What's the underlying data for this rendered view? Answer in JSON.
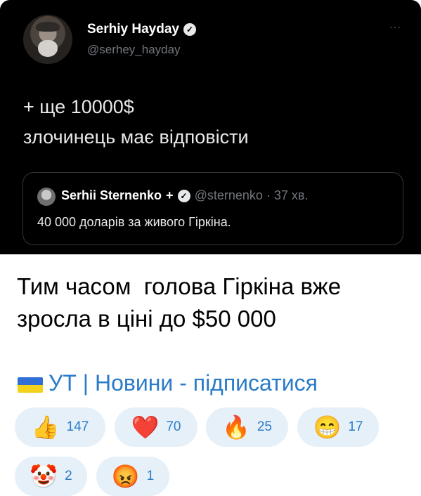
{
  "tweet": {
    "author_name": "Serhiy Hayday",
    "author_handle": "@serhey_hayday",
    "more_label": "···",
    "lines": [
      "+ ще 10000$",
      "злочинець має відповісти"
    ],
    "quote": {
      "author_name": "Serhii Sternenko",
      "cross": "+",
      "meta": "@sternenko · 37 хв.",
      "text": "40 000 доларів за живого Гіркіна."
    }
  },
  "post": {
    "lines": [
      "Тим часом  голова Гіркіна вже",
      "зросла в ціні до $50 000"
    ]
  },
  "channel_link": {
    "flag_icon": "ukraine-flag-icon",
    "text": "УТ | Новини - підписатися",
    "color": "#2a7bc8"
  },
  "reactions": [
    {
      "emoji": "👍",
      "icon": "thumbs-up-icon",
      "count": "147"
    },
    {
      "emoji": "❤️",
      "icon": "heart-icon",
      "count": "70"
    },
    {
      "emoji": "🔥",
      "icon": "fire-icon",
      "count": "25"
    },
    {
      "emoji": "😁",
      "icon": "grin-icon",
      "count": "17"
    },
    {
      "emoji": "🤡",
      "icon": "clown-icon",
      "count": "2"
    },
    {
      "emoji": "😡",
      "icon": "angry-face-icon",
      "count": "1"
    }
  ],
  "colors": {
    "tweet_bg": "#000000",
    "link": "#2a7bc8",
    "reaction_bg": "#e6f0f9"
  }
}
